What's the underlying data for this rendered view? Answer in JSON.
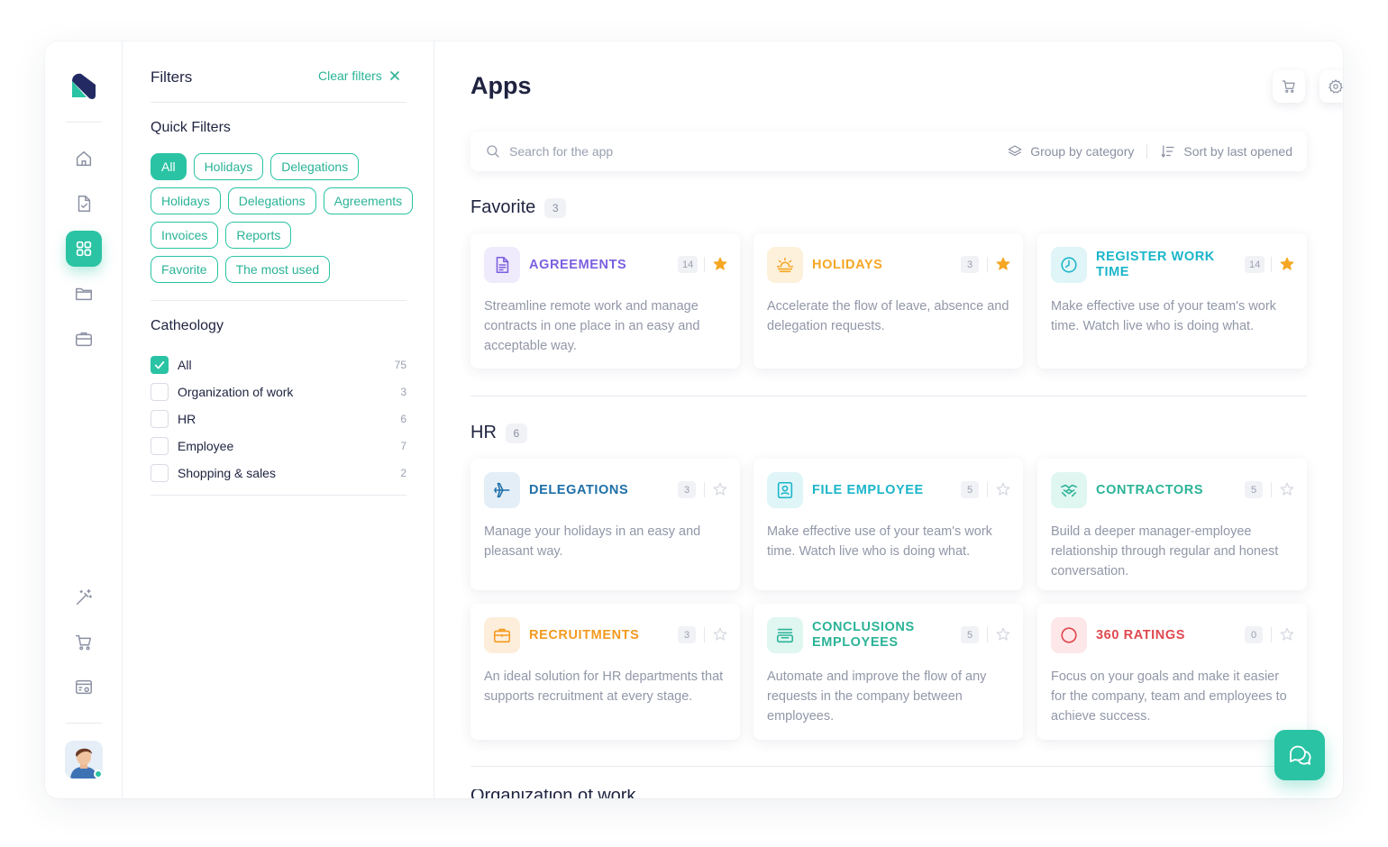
{
  "app": {
    "title": "Apps"
  },
  "colors": {
    "accent": "#2ac3a4",
    "text": "#1f2340",
    "muted": "#9297a8",
    "star_active": "#f5a623",
    "star_inactive": "#d5d8e0"
  },
  "rail": {
    "top_items": [
      {
        "icon": "home-icon",
        "active": false
      },
      {
        "icon": "document-check-icon",
        "active": false
      },
      {
        "icon": "apps-grid-icon",
        "active": true
      },
      {
        "icon": "folder-icon",
        "active": false
      },
      {
        "icon": "briefcase-icon",
        "active": false
      }
    ],
    "bottom_items": [
      {
        "icon": "magic-wand-icon"
      },
      {
        "icon": "cart-icon"
      },
      {
        "icon": "browser-settings-icon"
      }
    ],
    "user_status": "online"
  },
  "filters": {
    "title": "Filters",
    "clear_label": "Clear filters",
    "quick_title": "Quick Filters",
    "quick_rows": [
      [
        {
          "label": "All",
          "active": true
        },
        {
          "label": "Holidays",
          "active": false
        },
        {
          "label": "Delegations",
          "active": false
        }
      ],
      [
        {
          "label": "Holidays",
          "active": false
        },
        {
          "label": "Delegations",
          "active": false
        },
        {
          "label": "Agreements",
          "active": false
        }
      ],
      [
        {
          "label": "Invoices",
          "active": false
        },
        {
          "label": "Reports",
          "active": false
        }
      ],
      [
        {
          "label": "Favorite",
          "active": false
        },
        {
          "label": "The most used",
          "active": false
        }
      ]
    ],
    "category_title": "Catheology",
    "categories": [
      {
        "label": "All",
        "count": "75",
        "checked": true
      },
      {
        "label": "Organization of work",
        "count": "3",
        "checked": false
      },
      {
        "label": "HR",
        "count": "6",
        "checked": false
      },
      {
        "label": "Employee",
        "count": "7",
        "checked": false
      },
      {
        "label": "Shopping & sales",
        "count": "2",
        "checked": false
      }
    ]
  },
  "toolbar": {
    "search_placeholder": "Search for the app",
    "group_label": "Group by category",
    "sort_label": "Sort by last opened"
  },
  "sections": {
    "favorite": {
      "name": "Favorite",
      "count": "3",
      "cards": [
        {
          "title": "Agreements",
          "count": "14",
          "starred": true,
          "color": "#7b5fe0",
          "bg": "#efeafc",
          "icon": "document-icon",
          "desc": "Streamline remote work and manage contracts in one place in an easy and acceptable way."
        },
        {
          "title": "Holidays",
          "count": "3",
          "starred": true,
          "color": "#f5a623",
          "bg": "#fdf1dc",
          "icon": "sunset-icon",
          "desc": "Accelerate the flow of leave, absence and delegation requests."
        },
        {
          "title": "Register work time",
          "count": "14",
          "starred": true,
          "color": "#1bb5c9",
          "bg": "#dff5f8",
          "icon": "clock-icon",
          "desc": "Make effective use of your team's work time. Watch live who is doing what."
        }
      ]
    },
    "hr": {
      "name": "HR",
      "count": "6",
      "cards": [
        {
          "title": "Delegations",
          "count": "3",
          "starred": false,
          "color": "#1e6fa8",
          "bg": "#e3eef7",
          "icon": "airplane-icon",
          "desc": "Manage your holidays in an easy and pleasant way."
        },
        {
          "title": "File employee",
          "count": "5",
          "starred": false,
          "color": "#1bb5c9",
          "bg": "#dff5f8",
          "icon": "id-card-icon",
          "desc": "Make effective use of your team's work time. Watch live who is doing what."
        },
        {
          "title": "Contractors",
          "count": "5",
          "starred": false,
          "color": "#2ab397",
          "bg": "#e0f6f1",
          "icon": "handshake-icon",
          "desc": "Build a deeper manager-employee relationship through regular and honest conversation."
        },
        {
          "title": "Recruitments",
          "count": "3",
          "starred": false,
          "color": "#f39a1f",
          "bg": "#fdeedb",
          "icon": "briefcase-icon",
          "desc": "An ideal solution for HR departments that supports recruitment at every stage."
        },
        {
          "title": "Conclusions employees",
          "count": "5",
          "starred": false,
          "color": "#2ab397",
          "bg": "#e0f6f1",
          "icon": "inbox-icon",
          "desc": "Automate and improve the flow of any requests in the company between employees."
        },
        {
          "title": "360 ratings",
          "count": "0",
          "starred": false,
          "color": "#e0484f",
          "bg": "#fde7e8",
          "icon": "circle-icon",
          "desc": "Focus on your goals and make it easier for the company, team and employees to achieve success."
        }
      ]
    },
    "next": {
      "name": "Organization of work"
    }
  }
}
